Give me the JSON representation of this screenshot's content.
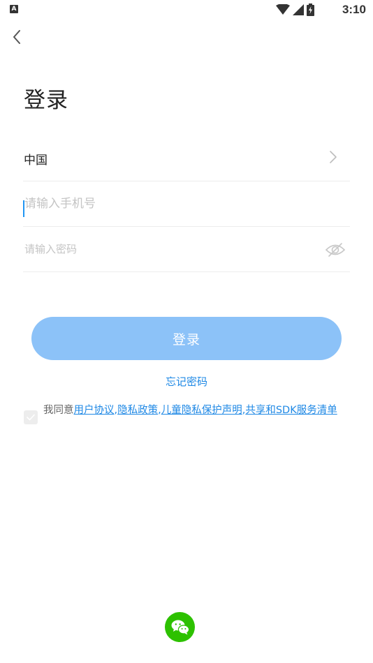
{
  "status_bar": {
    "notification_icon_letter": "A",
    "time": "3:10"
  },
  "page": {
    "title": "登录"
  },
  "form": {
    "country": "中国",
    "phone_placeholder": "请输入手机号",
    "password_placeholder": "请输入密码",
    "login_button": "登录",
    "forgot_password": "忘记密码"
  },
  "agreement": {
    "prefix": "我同意",
    "links": [
      "用户协议",
      "隐私政策",
      "儿童隐私保护声明",
      "共享和SDK服务清单"
    ],
    "separator": ","
  },
  "colors": {
    "accent": "#1e88e5",
    "login_button_bg": "#8cc2f8",
    "wechat_green": "#2dc100"
  },
  "icons": {
    "back": "chevron-left-icon",
    "country_arrow": "chevron-right-icon",
    "password_visibility": "eye-off-icon",
    "social_login": "wechat-icon"
  }
}
